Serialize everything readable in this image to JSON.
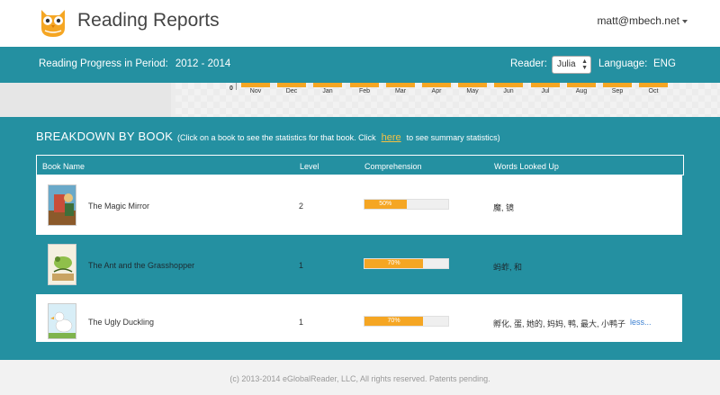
{
  "header": {
    "title": "Reading Reports",
    "user_email": "matt@mbech.net",
    "logo_icon": "owl-logo-icon"
  },
  "period": {
    "label": "Reading Progress in Period:",
    "range": "2012 - 2014",
    "reader_label": "Reader:",
    "reader_value": "Julia",
    "language_label": "Language:",
    "language_value": "ENG"
  },
  "chart_data": {
    "type": "bar",
    "categories": [
      "Nov",
      "Dec",
      "Jan",
      "Feb",
      "Mar",
      "Apr",
      "May",
      "Jun",
      "Jul",
      "Aug",
      "Sep",
      "Oct"
    ],
    "y_tick_visible": "0",
    "bar_color": "#f5a623"
  },
  "breakdown": {
    "title": "BREAKDOWN BY BOOK",
    "hint_before": "(Click on a book to see the statistics for that book. Click",
    "hint_link": "here",
    "hint_after": "to see summary statistics)",
    "columns": [
      "Book Name",
      "Level",
      "Comprehension",
      "Words Looked Up"
    ],
    "rows": [
      {
        "name": "The Magic Mirror",
        "level": "2",
        "comprehension": "50%",
        "comprehension_value": 0.5,
        "words": "魔, 镜",
        "extra": ""
      },
      {
        "name": "The Ant and the Grasshopper",
        "level": "1",
        "comprehension": "70%",
        "comprehension_value": 0.7,
        "words": "蚂蚱, 和",
        "extra": ""
      },
      {
        "name": "The Ugly Duckling",
        "level": "1",
        "comprehension": "70%",
        "comprehension_value": 0.7,
        "words": "孵化, 蛋, 她的, 妈妈, 鸭, 最大, 小鸭子",
        "extra": "less..."
      }
    ]
  },
  "footer": {
    "text": "(c) 2013-2014 eGlobalReader, LLC, All rights reserved. Patents pending."
  },
  "colors": {
    "teal": "#2490a1",
    "accent": "#f5a623",
    "link": "#3a7fd1"
  }
}
